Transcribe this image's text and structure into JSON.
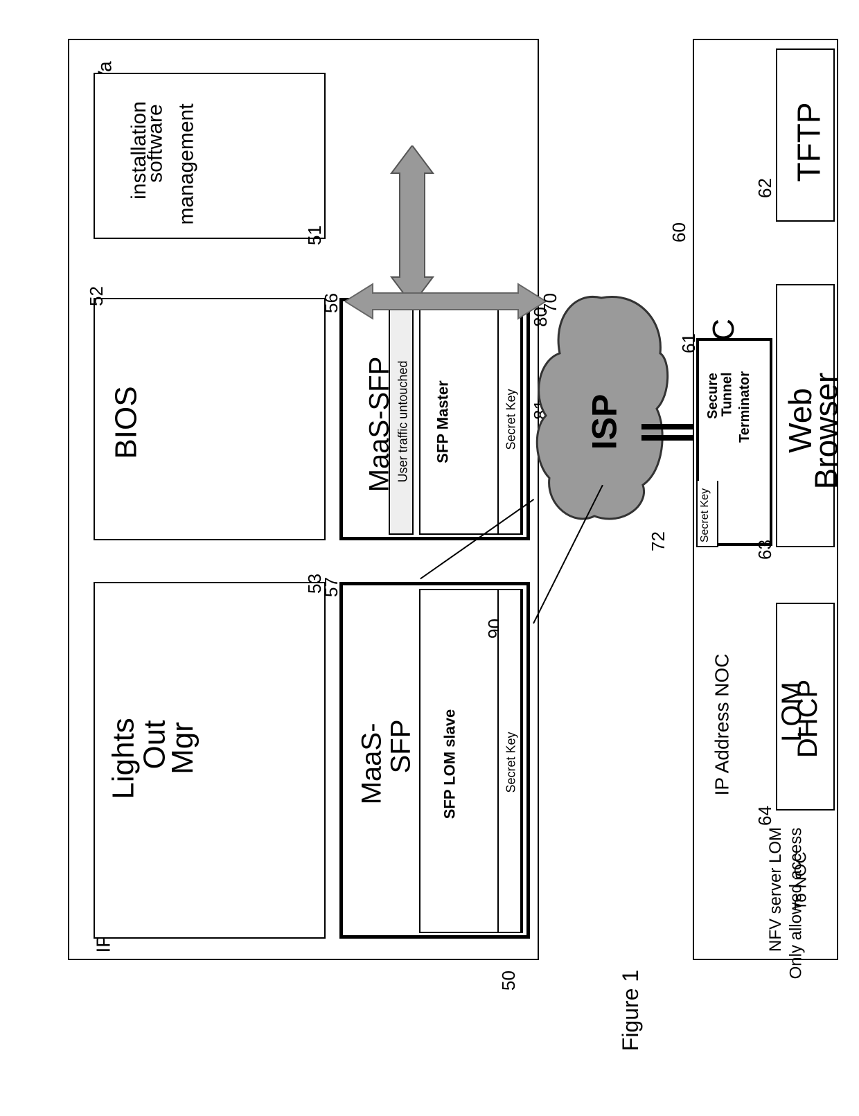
{
  "figure_label": "Figure 1",
  "left_device": {
    "ip_top": "IP Address HVa",
    "ip_bottom": "IP Address LOMa",
    "install_block": {
      "lines": [
        "installation",
        "software",
        "management"
      ],
      "ref": "51"
    },
    "bios": {
      "label": "BIOS",
      "ref": "52"
    },
    "lom": {
      "lines": [
        "Lights",
        "Out",
        "Mgr"
      ],
      "ref": "53"
    },
    "sfp_top": {
      "title": "MaaS-SFP",
      "sub": "User traffic untouched",
      "master": "SFP Master",
      "secret": "Secret Key",
      "ref_box": "56",
      "ref_master": "81",
      "ref_title": "80"
    },
    "sfp_bottom": {
      "title_line1": "MaaS-",
      "title_line2": "SFP",
      "slave": "SFP LOM slave",
      "secret": "Secret Key",
      "ref_box": "57",
      "ref_slave": "90"
    },
    "ref_outer": "50"
  },
  "cloud": {
    "label": "ISP",
    "ref": "70",
    "ref_line": "72"
  },
  "noc": {
    "title": "NOC",
    "ref_outer": "60",
    "stt": {
      "line1": "Secure",
      "line2": "Tunnel",
      "line3": "Terminator",
      "secret": "Secret Key",
      "ref": "61"
    },
    "tftp": {
      "label": "TFTP",
      "ref": "62"
    },
    "browser": {
      "line1": "Web",
      "line2": "Browser",
      "ref": "63"
    },
    "lomdhcp": {
      "line1": "LOM",
      "line2": "DHCP",
      "ref": "64"
    },
    "ip": "IP Address NOC",
    "note_line1": "NFV server LOM",
    "note_line2": "Only allowed access",
    "note_line3": "To NOC"
  }
}
